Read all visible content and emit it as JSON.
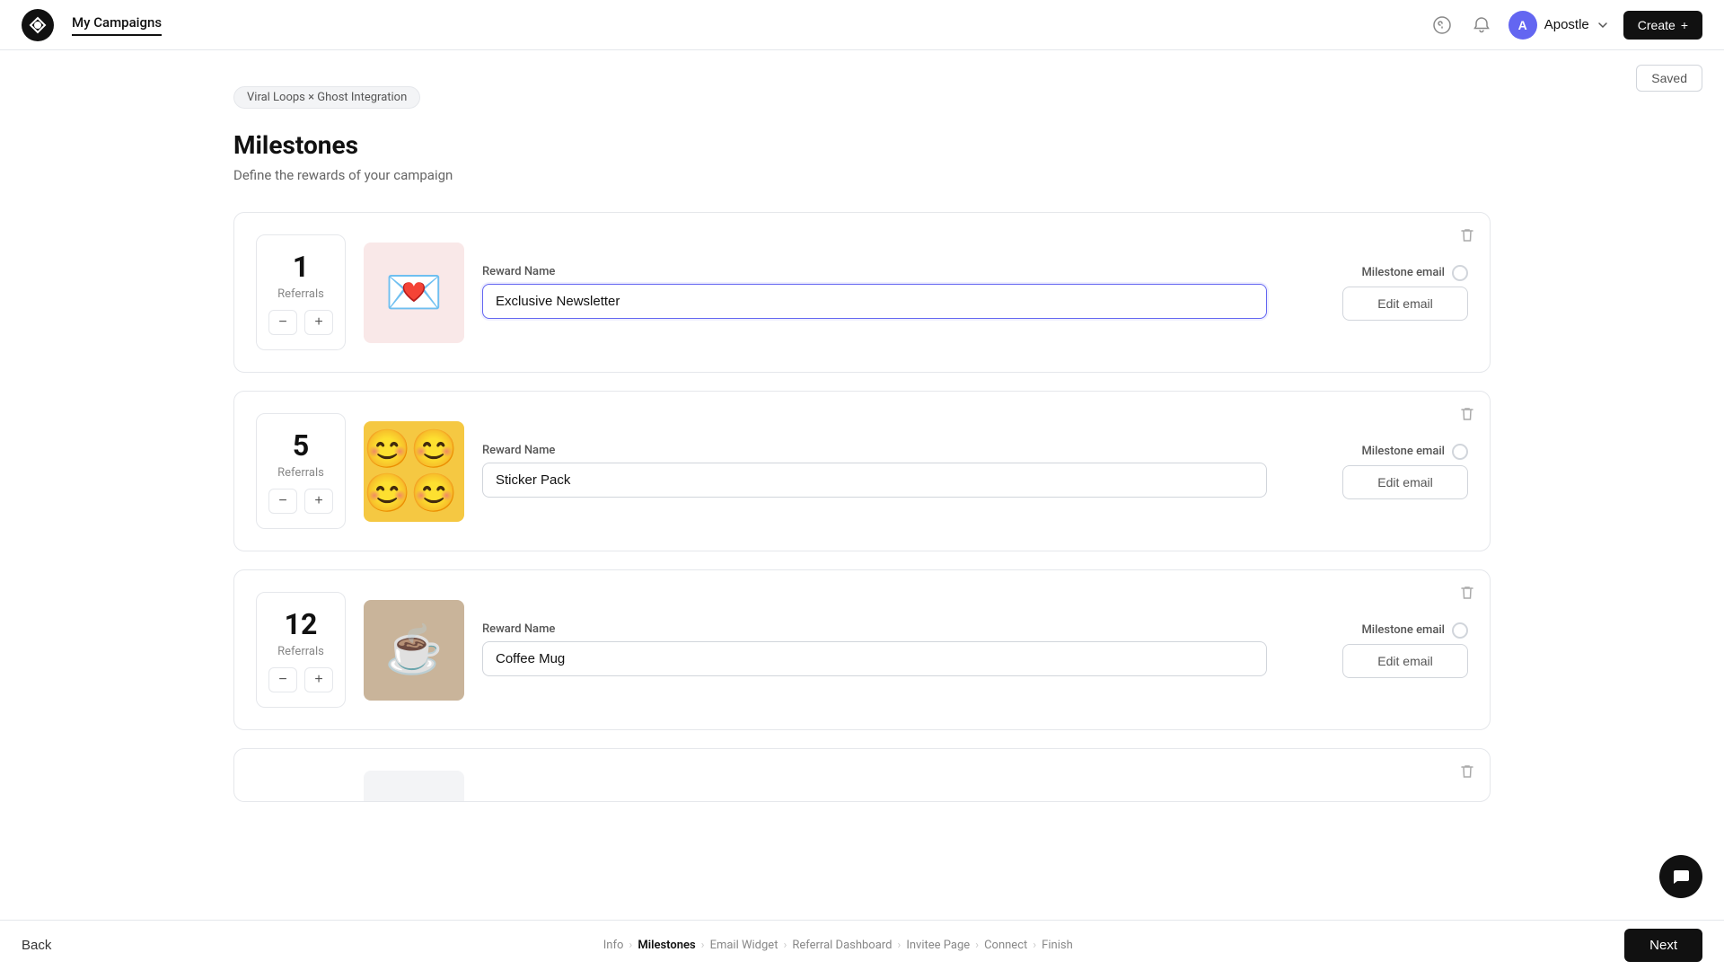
{
  "header": {
    "logo_alt": "Viral Loops logo",
    "nav_label": "My Campaigns",
    "create_label": "Create",
    "create_icon": "+",
    "user_initial": "A",
    "user_name": "Apostle",
    "saved_label": "Saved"
  },
  "breadcrumb_pill": "Viral Loops × Ghost Integration",
  "page": {
    "title": "Milestones",
    "subtitle": "Define the rewards of your campaign"
  },
  "milestones": [
    {
      "id": 1,
      "referrals": "1",
      "referrals_label": "Referrals",
      "reward_name_label": "Reward Name",
      "reward_name_value": "Exclusive Newsletter",
      "milestone_email_label": "Milestone email",
      "edit_email_label": "Edit email",
      "image_type": "heart",
      "image_emoji": "💌"
    },
    {
      "id": 2,
      "referrals": "5",
      "referrals_label": "Referrals",
      "reward_name_label": "Reward Name",
      "reward_name_value": "Sticker Pack",
      "milestone_email_label": "Milestone email",
      "edit_email_label": "Edit email",
      "image_type": "smiley",
      "image_emoji": "😊"
    },
    {
      "id": 3,
      "referrals": "12",
      "referrals_label": "Referrals",
      "reward_name_label": "Reward Name",
      "reward_name_value": "Coffee Mug",
      "milestone_email_label": "Milestone email",
      "edit_email_label": "Edit email",
      "image_type": "coffee",
      "image_emoji": "☕"
    }
  ],
  "footer": {
    "back_label": "Back",
    "next_label": "Next",
    "breadcrumbs": [
      {
        "label": "Info",
        "active": false
      },
      {
        "label": "Milestones",
        "active": true
      },
      {
        "label": "Email Widget",
        "active": false
      },
      {
        "label": "Referral Dashboard",
        "active": false
      },
      {
        "label": "Invitee Page",
        "active": false
      },
      {
        "label": "Connect",
        "active": false
      },
      {
        "label": "Finish",
        "active": false
      }
    ]
  },
  "chat_icon": "💬"
}
